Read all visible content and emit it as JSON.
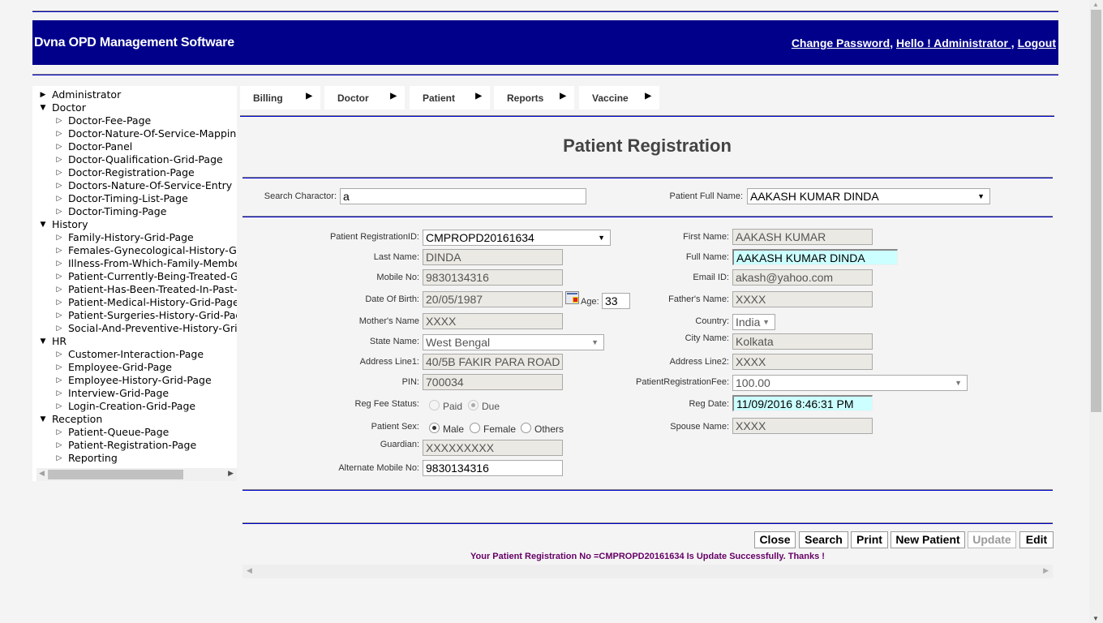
{
  "header": {
    "app_title": "Dvna OPD Management Software",
    "change_password": "Change Password",
    "separator": ",",
    "hello_user": "Hello ! Administrator ,",
    "logout": "Logout"
  },
  "sidebar": {
    "tree": [
      {
        "label": "Administrator",
        "expanded": false,
        "children": []
      },
      {
        "label": "Doctor",
        "expanded": true,
        "children": [
          "Doctor-Fee-Page",
          "Doctor-Nature-Of-Service-Mapping-",
          "Doctor-Panel",
          "Doctor-Qualification-Grid-Page",
          "Doctor-Registration-Page",
          "Doctors-Nature-Of-Service-Entry",
          "Doctor-Timing-List-Page",
          "Doctor-Timing-Page"
        ]
      },
      {
        "label": "History",
        "expanded": true,
        "children": [
          "Family-History-Grid-Page",
          "Females-Gynecological-History-Grid",
          "Illness-From-Which-Family-Member",
          "Patient-Currently-Being-Treated-Gri",
          "Patient-Has-Been-Treated-In-Past-(",
          "Patient-Medical-History-Grid-Page",
          "Patient-Surgeries-History-Grid-Page",
          "Social-And-Preventive-History-Grid-"
        ]
      },
      {
        "label": "HR",
        "expanded": true,
        "children": [
          "Customer-Interaction-Page",
          "Employee-Grid-Page",
          "Employee-History-Grid-Page",
          "Interview-Grid-Page",
          "Login-Creation-Grid-Page"
        ]
      },
      {
        "label": "Reception",
        "expanded": true,
        "children": [
          "Patient-Queue-Page",
          "Patient-Registration-Page",
          "Reporting"
        ]
      }
    ]
  },
  "menu": [
    {
      "label": "Billing"
    },
    {
      "label": "Doctor"
    },
    {
      "label": "Patient"
    },
    {
      "label": "Reports"
    },
    {
      "label": "Vaccine"
    }
  ],
  "page_title": "Patient Registration",
  "search": {
    "search_label": "Search Charactor:",
    "search_value": "a",
    "full_name_label": "Patient Full Name:",
    "full_name_value": "AAKASH KUMAR DINDA"
  },
  "form": {
    "reg_id": {
      "label": "Patient RegistrationID:",
      "value": "CMPROPD20161634"
    },
    "last_name": {
      "label": "Last Name:",
      "value": "DINDA"
    },
    "mobile": {
      "label": "Mobile No:",
      "value": "9830134316"
    },
    "dob": {
      "label": "Date Of Birth:",
      "value": "20/05/1987"
    },
    "age": {
      "label": "Age:",
      "value": "33"
    },
    "mother": {
      "label": "Mother's Name",
      "value": "XXXX"
    },
    "state": {
      "label": "State Name:",
      "value": "West Bengal"
    },
    "address1": {
      "label": "Address Line1:",
      "value": "40/5B FAKIR PARA ROAD"
    },
    "pin": {
      "label": "PIN:",
      "value": "700034"
    },
    "reg_fee_status": {
      "label": "Reg Fee Status:",
      "options": [
        "Paid",
        "Due"
      ],
      "selected": "Due"
    },
    "sex": {
      "label": "Patient Sex:",
      "options": [
        "Male",
        "Female",
        "Others"
      ],
      "selected": "Male"
    },
    "guardian": {
      "label": "Guardian:",
      "value": "XXXXXXXXX"
    },
    "alt_mobile": {
      "label": "Alternate Mobile No:",
      "value": "9830134316"
    },
    "first_name": {
      "label": "First Name:",
      "value": "AAKASH KUMAR"
    },
    "full_name": {
      "label": "Full Name:",
      "value": "AAKASH KUMAR DINDA"
    },
    "email": {
      "label": "Email ID:",
      "value": "akash@yahoo.com"
    },
    "father": {
      "label": "Father's Name:",
      "value": "XXXX"
    },
    "country": {
      "label": "Country:",
      "value": "India"
    },
    "city": {
      "label": "City Name:",
      "value": "Kolkata"
    },
    "address2": {
      "label": "Address Line2:",
      "value": "XXXX"
    },
    "reg_fee": {
      "label": "PatientRegistrationFee:",
      "value": "100.00"
    },
    "reg_date": {
      "label": "Reg Date:",
      "value": "11/09/2016 8:46:31 PM"
    },
    "spouse": {
      "label": "Spouse Name:",
      "value": "XXXX"
    }
  },
  "actions": {
    "close": "Close",
    "search": "Search",
    "print": "Print",
    "new_patient": "New Patient",
    "update": "Update",
    "edit": "Edit"
  },
  "status_message": "Your Patient Registration No =CMPROPD20161634 Is Update Successfully. Thanks !",
  "icons": {
    "collapsed": "▶",
    "expanded": "▼",
    "leaf": "▷",
    "menu_arrow": "▶",
    "dropdown": "▼",
    "scroll_left": "◀",
    "scroll_right": "▶",
    "scroll_up": "▲",
    "scroll_down": "▼"
  }
}
